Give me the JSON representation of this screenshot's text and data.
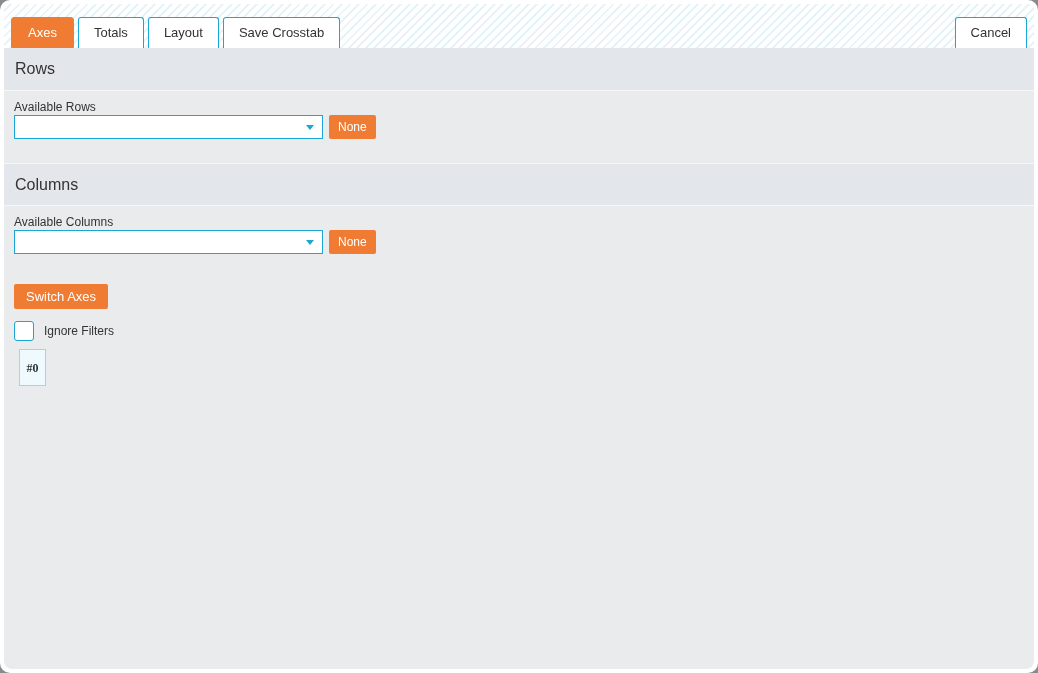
{
  "tabs": [
    {
      "label": "Axes",
      "selected": true
    },
    {
      "label": "Totals",
      "selected": false
    },
    {
      "label": "Layout",
      "selected": false
    },
    {
      "label": "Save Crosstab",
      "selected": false
    }
  ],
  "cancel_button": "Cancel",
  "sections": [
    {
      "title": "Rows",
      "field_label": "Available Rows",
      "none_button": "None"
    },
    {
      "title": "Columns",
      "field_label": "Available Columns",
      "none_button": "None"
    }
  ],
  "switch_button": "Switch Axes",
  "ignore_filters": {
    "label": "Ignore Filters",
    "checked": false
  },
  "crosstab_cell": "#0"
}
